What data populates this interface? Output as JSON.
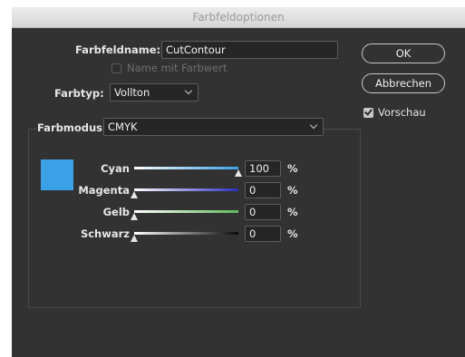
{
  "dialog": {
    "title": "Farbfeldoptionen"
  },
  "form": {
    "name_label": "Farbfeldname:",
    "name_value": "CutContour",
    "name_with_value_label": "Name mit Farbwert",
    "name_with_value_checked": false,
    "type_label": "Farbtyp:",
    "type_value": "Vollton",
    "mode_label": "Farbmodus:",
    "mode_value": "CMYK"
  },
  "buttons": {
    "ok": "OK",
    "cancel": "Abbrechen"
  },
  "preview": {
    "label": "Vorschau",
    "checked": true
  },
  "swatch_color": "#3ba1e6",
  "channels": [
    {
      "label": "Cyan",
      "value": "100",
      "unit": "%",
      "fraction": 1.0,
      "color": "#3ba1e6"
    },
    {
      "label": "Magenta",
      "value": "0",
      "unit": "%",
      "fraction": 0.0,
      "color": "#2c2ec0"
    },
    {
      "label": "Gelb",
      "value": "0",
      "unit": "%",
      "fraction": 0.0,
      "color": "#5eb85a"
    },
    {
      "label": "Schwarz",
      "value": "0",
      "unit": "%",
      "fraction": 0.0,
      "color": "#0a0a0a"
    }
  ]
}
